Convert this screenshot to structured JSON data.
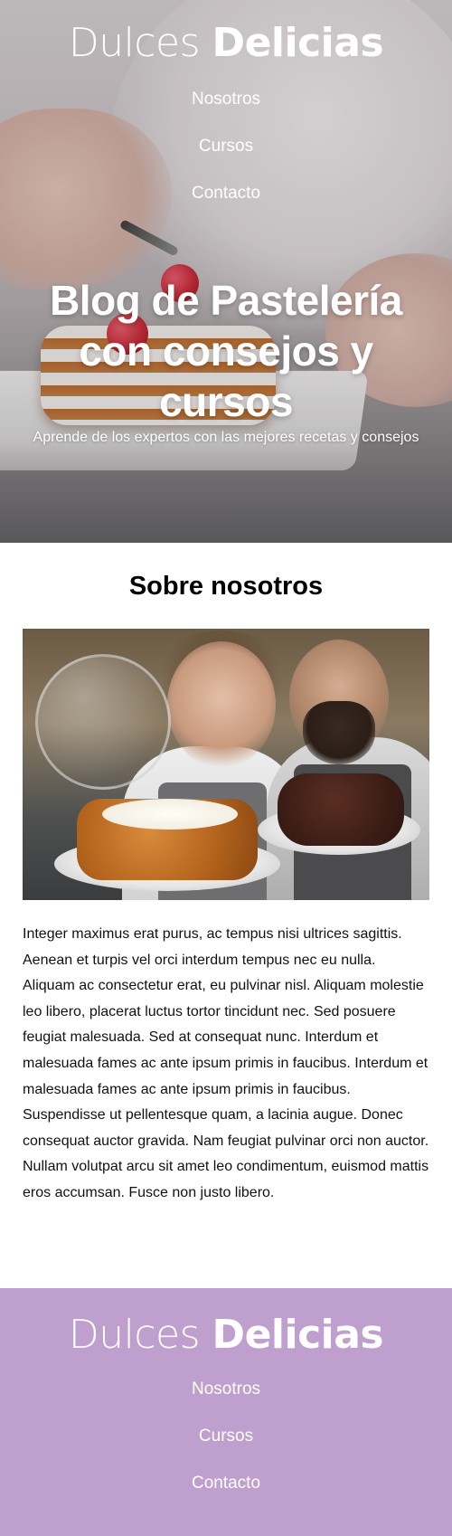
{
  "header": {
    "brand_light": "Dulces",
    "brand_bold": "Delicias",
    "nav": [
      {
        "label": "Nosotros"
      },
      {
        "label": "Cursos"
      },
      {
        "label": "Contacto"
      }
    ]
  },
  "hero": {
    "title": "Blog de Pastelería con consejos y cursos",
    "subtitle": "Aprende de los expertos con las mejores recetas y consejos"
  },
  "about": {
    "title": "Sobre nosotros",
    "text": "Integer maximus erat purus, ac tempus nisi ultrices sagittis. Aenean et turpis vel orci interdum tempus nec eu nulla. Aliquam ac consectetur erat, eu pulvinar nisl. Aliquam molestie leo libero, placerat luctus tortor tincidunt nec. Sed posuere feugiat malesuada. Sed at consequat nunc. Interdum et malesuada fames ac ante ipsum primis in faucibus. Interdum et malesuada fames ac ante ipsum primis in faucibus. Suspendisse ut pellentesque quam, a lacinia augue. Donec consequat auctor gravida. Nam feugiat pulvinar orci non auctor. Nullam volutpat arcu sit amet leo condimentum, euismod mattis eros accumsan. Fusce non justo libero."
  },
  "footer": {
    "brand_light": "Dulces",
    "brand_bold": "Delicias",
    "background_color": "#bf9fcd",
    "nav": [
      {
        "label": "Nosotros"
      },
      {
        "label": "Cursos"
      },
      {
        "label": "Contacto"
      }
    ]
  }
}
